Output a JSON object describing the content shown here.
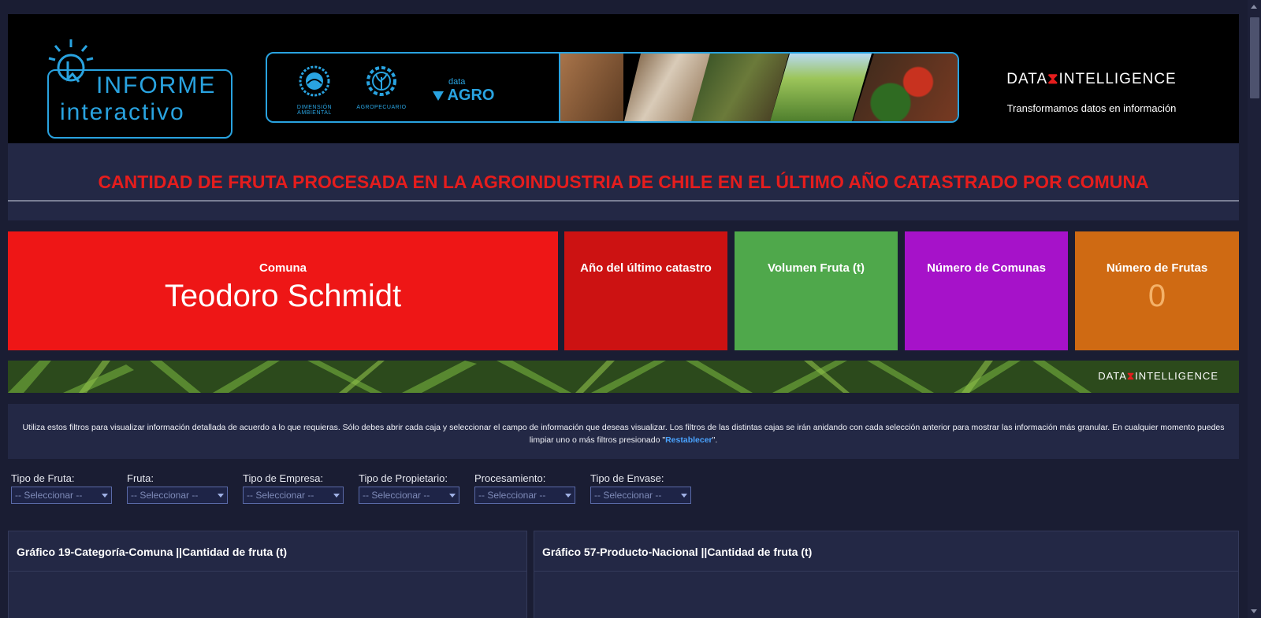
{
  "colors": {
    "page_bg": "#1a1d33",
    "panel_bg": "#232845",
    "title_red": "#e51d1d",
    "brand_blue": "#29a3e0",
    "link_blue": "#4aa3ff"
  },
  "header": {
    "logo": {
      "line1": "INFORME",
      "line2": "interactivo",
      "icon": "pointer-hand-icon"
    },
    "partners": [
      {
        "caption": "DIMENSIÓN AMBIENTAL",
        "icon": "sun-emblem-icon"
      },
      {
        "caption": "AGROPECUARIO",
        "icon": "gear-plant-icon"
      }
    ],
    "data_agro": {
      "small": "data",
      "big": "AGRO"
    },
    "photo_strip": [
      "tractor-photo",
      "cow-photo",
      "farmer-photo",
      "field-rows-photo",
      "vegetables-photo"
    ],
    "brand": {
      "name_left": "DATA",
      "name_right": "INTELLIGENCE",
      "tagline": "Transformamos datos en información"
    }
  },
  "page_title": "CANTIDAD DE FRUTA PROCESADA EN LA AGROINDUSTRIA DE CHILE EN EL ÚLTIMO AÑO CATASTRADO POR COMUNA",
  "kpis": [
    {
      "label": "Comuna",
      "value": "Teodoro Schmidt",
      "color": "#ee1616"
    },
    {
      "label": "Año del último catastro",
      "value": "",
      "color": "#cc1212"
    },
    {
      "label": "Volumen Fruta (t)",
      "value": "",
      "color": "#4fa84b"
    },
    {
      "label": "Número de Comunas",
      "value": "",
      "color": "#a612c9"
    },
    {
      "label": "Número de Frutas",
      "value": "0",
      "color": "#cf6a13"
    }
  ],
  "band_brand": {
    "name_left": "DATA",
    "name_right": "INTELLIGENCE"
  },
  "info": {
    "text_before": "Utiliza estos filtros para visualizar información detallada de acuerdo a lo que requieras. Sólo debes abrir cada caja y seleccionar el campo de información que deseas visualizar. Los filtros de las distintas cajas se irán anidando con cada selección anterior para mostrar las información más granular. En cualquier momento puedes limpiar uno o más filtros presionado \"",
    "link": "Restablecer",
    "text_after": "\"."
  },
  "filters": [
    {
      "label": "Tipo de Fruta:",
      "value": "-- Seleccionar --"
    },
    {
      "label": "Fruta:",
      "value": "-- Seleccionar --"
    },
    {
      "label": "Tipo de Empresa:",
      "value": "-- Seleccionar --"
    },
    {
      "label": "Tipo de Propietario:",
      "value": "-- Seleccionar --"
    },
    {
      "label": "Procesamiento:",
      "value": "-- Seleccionar --"
    },
    {
      "label": "Tipo de Envase:",
      "value": "-- Seleccionar --"
    }
  ],
  "charts": [
    {
      "title": "Gráfico 19-Categoría-Comuna ||Cantidad de fruta (t)"
    },
    {
      "title": "Gráfico 57-Producto-Nacional ||Cantidad de fruta (t)"
    }
  ]
}
